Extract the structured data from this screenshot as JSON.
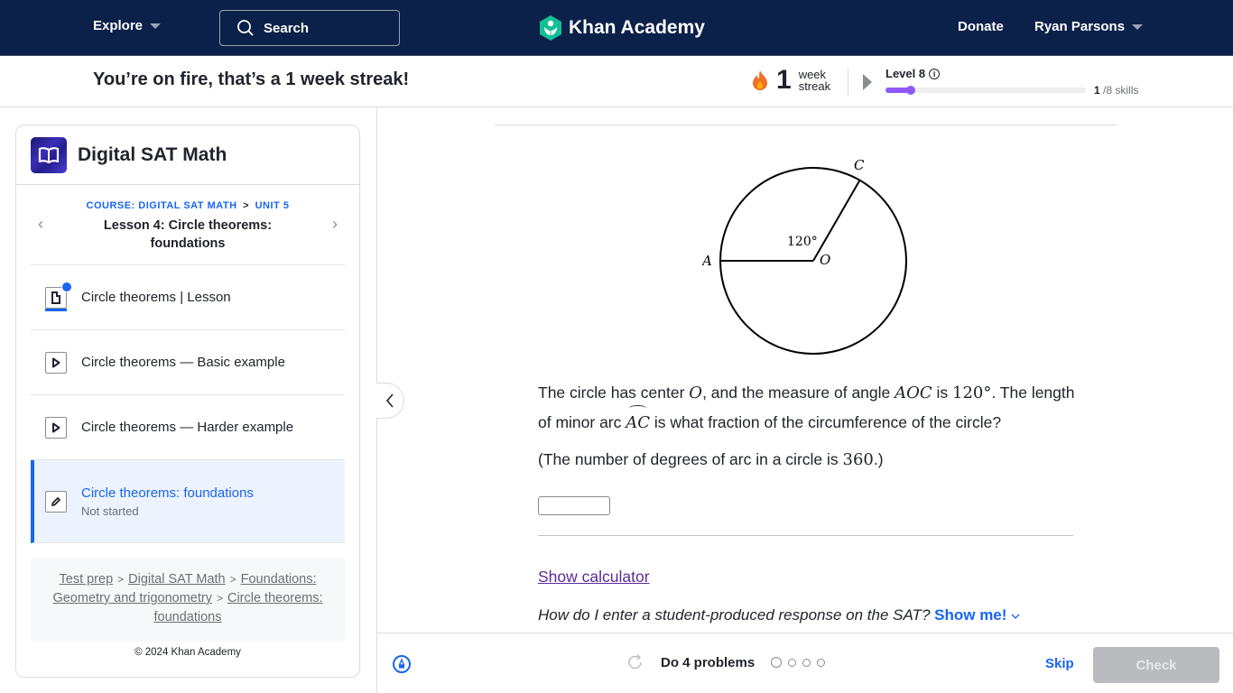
{
  "topnav": {
    "explore_label": "Explore",
    "search_placeholder": "Search",
    "logo_text": "Khan Academy",
    "donate_label": "Donate",
    "user_name": "Ryan Parsons",
    "bg_color": "#0b2149"
  },
  "streak": {
    "message": "You’re on fire, that’s a 1 week streak!",
    "count": "1",
    "unit_line1": "week",
    "unit_line2": "streak",
    "level_label": "Level 8",
    "level_progress_fraction": 0.125,
    "skills_done": "1",
    "skills_total": "/8 skills"
  },
  "sidebar": {
    "course_title": "Digital SAT Math",
    "crumb_course": "COURSE: DIGITAL SAT MATH",
    "crumb_sep": ">",
    "crumb_unit": "UNIT 5",
    "lesson_title": "Lesson 4: Circle theorems: foundations",
    "items": [
      {
        "label": "Circle theorems | Lesson",
        "icon": "article-icon",
        "completed": true
      },
      {
        "label": "Circle theorems — Basic example",
        "icon": "video-icon"
      },
      {
        "label": "Circle theorems — Harder example",
        "icon": "video-icon"
      },
      {
        "label": "Circle theorems: foundations",
        "icon": "pencil-icon",
        "status": "Not started",
        "active": true
      }
    ],
    "breadcrumb": [
      "Test prep",
      "Digital SAT Math",
      "Foundations: Geometry and trigonometry",
      "Circle theorems: foundations"
    ],
    "copyright": "© 2024 Khan Academy"
  },
  "figure": {
    "label_a": "A",
    "label_c": "C",
    "label_o": "O",
    "angle_label": "120°"
  },
  "question": {
    "p1_a": "The circle has center ",
    "p1_o": "O",
    "p1_b": ", and the measure of angle ",
    "p1_aoc": "AOC",
    "p1_c": " is ",
    "p1_angle": "120°",
    "p1_d": ". The length of minor arc ",
    "p1_arc": "AC",
    "p1_e": " is what fraction of the circumference of the circle?",
    "note_a": "(The number of degrees of arc in a circle is ",
    "note_num": "360",
    "note_b": ".)",
    "answer_value": ""
  },
  "links": {
    "show_calculator": "Show calculator",
    "help_text": "How do I enter a student-produced response on the SAT?",
    "show_me": "Show me!"
  },
  "footer": {
    "task_label": "Do 4 problems",
    "problems_total": 4,
    "problems_done": 0,
    "skip_label": "Skip",
    "check_label": "Check"
  }
}
